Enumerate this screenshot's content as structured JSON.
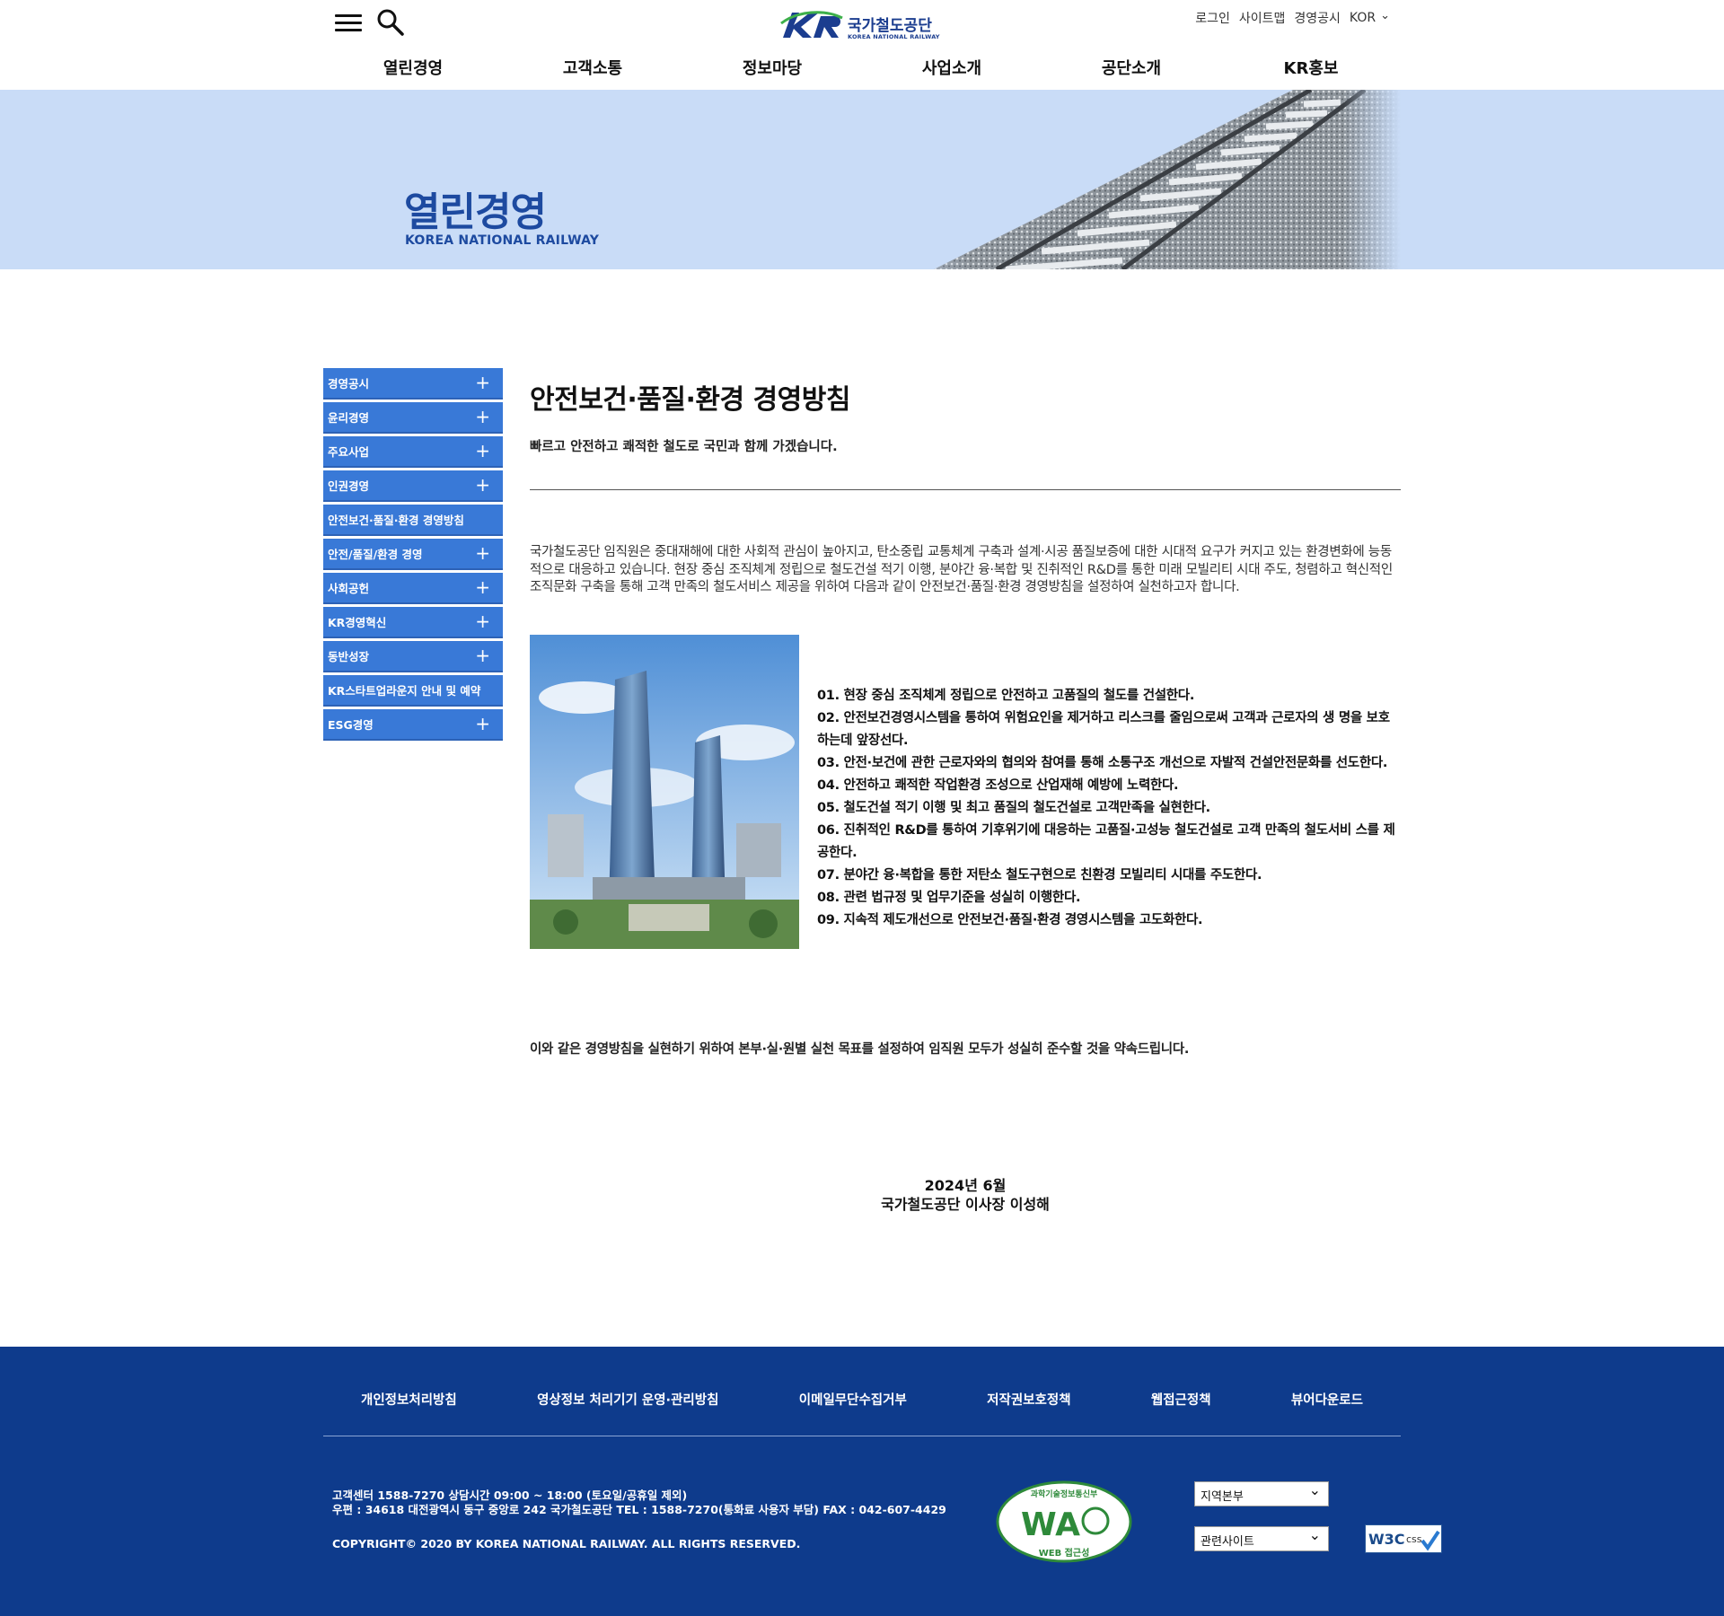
{
  "header": {
    "logo_text": "국가철도공단",
    "logo_sub": "KOREA NATIONAL RAILWAY",
    "util": [
      "로그인",
      "사이트맵",
      "경영공시",
      "KOR"
    ],
    "gnb": [
      "열린경영",
      "고객소통",
      "정보마당",
      "사업소개",
      "공단소개",
      "KR홍보"
    ]
  },
  "banner": {
    "title": "열린경영",
    "subtitle": "KOREA NATIONAL RAILWAY"
  },
  "lnb": [
    {
      "label": "경영공시",
      "expand": "+"
    },
    {
      "label": "윤리경영",
      "expand": "+"
    },
    {
      "label": "주요사업",
      "expand": "+"
    },
    {
      "label": "인권경영",
      "expand": "+"
    },
    {
      "label": "안전보건·품질·환경 경영방침",
      "expand": ""
    },
    {
      "label": "안전/품질/환경 경영",
      "expand": "+"
    },
    {
      "label": "사회공헌",
      "expand": "+"
    },
    {
      "label": "KR경영혁신",
      "expand": "+"
    },
    {
      "label": "동반성장",
      "expand": "+"
    },
    {
      "label": "KR스타트업라운지 안내 및 예약",
      "expand": ""
    },
    {
      "label": "ESG경영",
      "expand": "+"
    }
  ],
  "content": {
    "title": "안전보건·품질·환경 경영방침",
    "lead": "빠르고 안전하고 쾌적한 철도로 국민과 함께 가겠습니다.",
    "intro": "국가철도공단 임직원은 중대재해에 대한 사회적 관심이 높아지고, 탄소중립 교통체계 구축과 설계·시공 품질보증에 대한 시대적 요구가 커지고 있는 환경변화에 능동적으로 대응하고 있습니다. 현장 중심 조직체계 정립으로 철도건설 적기 이행, 분야간 융·복합 및 진취적인 R&D를 통한 미래 모빌리티 시대 주도, 청렴하고 혁신적인 조직문화 구축을 통해 고객 만족의 철도서비스 제공을 위하여 다음과 같이 안전보건·품질·환경 경영방침을 설정하여 실천하고자 합니다.",
    "policies": [
      "01. 현장 중심 조직체계 정립으로 안전하고 고품질의 철도를 건설한다.",
      "02. 안전보건경영시스템을 통하여 위험요인을 제거하고 리스크를 줄임으로써 고객과 근로자의 생 명을 보호하는데 앞장선다.",
      "03. 안전·보건에 관한 근로자와의 협의와 참여를 통해 소통구조 개선으로 자발적 건설안전문화를 선도한다.",
      "04. 안전하고 쾌적한 작업환경 조성으로 산업재해 예방에 노력한다.",
      "05. 철도건설 적기 이행 및 최고 품질의 철도건설로 고객만족을 실현한다.",
      "06. 진취적인 R&D를 통하여 기후위기에 대응하는 고품질·고성능 철도건설로 고객 만족의 철도서비 스를 제공한다.",
      "07. 분야간 융·복합을 통한 저탄소 철도구현으로 친환경 모빌리티 시대를 주도한다.",
      "08. 관련 법규정 및 업무기준을 성실히 이행한다.",
      "09. 지속적 제도개선으로 안전보건·품질·환경 경영시스템을 고도화한다."
    ],
    "closing": "이와 같은 경영방침을 실현하기 위하여 본부·실·원별 실천 목표를 설정하여 임직원 모두가 성실히 준수할 것을 약속드립니다.",
    "date": "2024년 6월",
    "signature": "국가철도공단 이사장 이성해"
  },
  "footer": {
    "links": [
      "개인정보처리방침",
      "영상정보 처리기기 운영·관리방침",
      "이메일무단수집거부",
      "저작권보호정책",
      "웹접근정책",
      "뷰어다운로드"
    ],
    "info_line1": "고객센터 1588-7270 상담시간 09:00 ~ 18:00 (토요일/공휴일 제외)",
    "info_line2": "우편 : 34618 대전광역시 동구 중앙로 242 국가철도공단 TEL : 1588-7270(통화료 사용자 부담) FAX : 042-607-4429",
    "copyright": "COPYRIGHT© 2020 BY KOREA NATIONAL RAILWAY. ALL RIGHTS RESERVED.",
    "select_region": "지역본부",
    "select_related": "관련사이트",
    "wa_top": "과학기술정보통신부",
    "wa_mark": "WA",
    "wa_bottom": "WEB 접근성",
    "w3c_label": "W3C",
    "w3c_css": "css"
  },
  "colors": {
    "lnb_blue": "#3979d7",
    "footer_navy": "#0e3b8c",
    "banner_bg": "#c9dcf7",
    "brand_blue": "#1d4aa0"
  }
}
